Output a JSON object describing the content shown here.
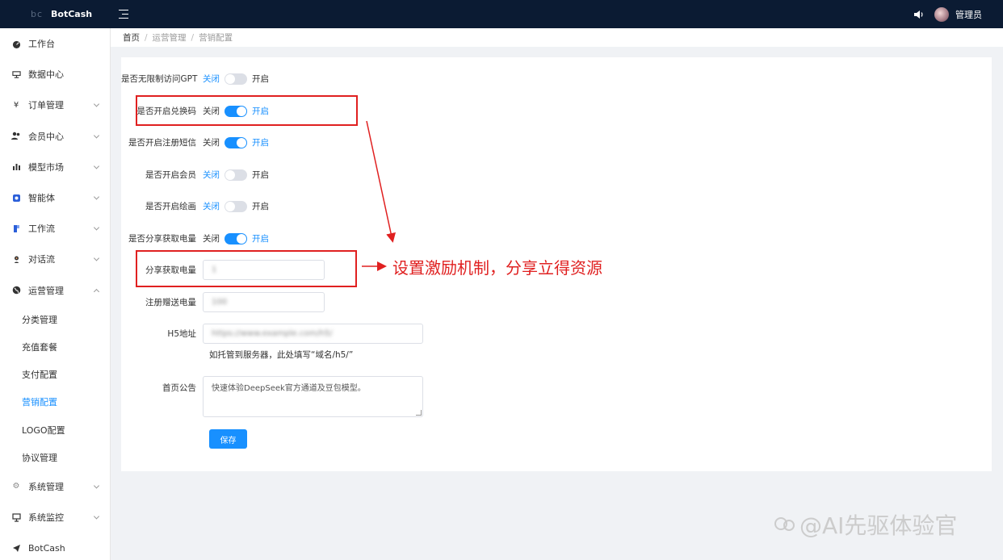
{
  "topbar": {
    "logo_text": "bc",
    "brand": "BotCash",
    "admin": "管理员"
  },
  "sidebar": {
    "items": [
      {
        "label": "工作台",
        "icon": "dashboard-icon"
      },
      {
        "label": "数据中心",
        "icon": "data-icon"
      },
      {
        "label": "订单管理",
        "icon": "yen-icon"
      },
      {
        "label": "会员中心",
        "icon": "users-icon"
      },
      {
        "label": "模型市场",
        "icon": "bar-chart-icon"
      },
      {
        "label": "智能体",
        "icon": "agent-icon"
      },
      {
        "label": "工作流",
        "icon": "workflow-icon"
      },
      {
        "label": "对话流",
        "icon": "chat-icon"
      },
      {
        "label": "运营管理",
        "icon": "globe-icon"
      }
    ],
    "sub_items": [
      "分类管理",
      "充值套餐",
      "支付配置",
      "营销配置",
      "LOGO配置",
      "协议管理"
    ],
    "bottom_items": [
      {
        "label": "系统管理",
        "icon": "gear-icon"
      },
      {
        "label": "系统监控",
        "icon": "monitor-icon"
      },
      {
        "label": "BotCash",
        "icon": "send-icon"
      }
    ]
  },
  "breadcrumb": {
    "home": "首页",
    "level1": "运营管理",
    "level2": "营销配置"
  },
  "form": {
    "off_label": "关闭",
    "on_label": "开启",
    "rows": [
      {
        "label": "是否无限制访问GPT",
        "state": "off"
      },
      {
        "label": "是否开启兑换码",
        "state": "on"
      },
      {
        "label": "是否开启注册短信",
        "state": "on"
      },
      {
        "label": "是否开启会员",
        "state": "off"
      },
      {
        "label": "是否开启绘画",
        "state": "off"
      },
      {
        "label": "是否分享获取电量",
        "state": "on"
      }
    ],
    "share_power_label": "分享获取电量",
    "share_power_value": "1",
    "register_power_label": "注册赠送电量",
    "register_power_value": "100",
    "h5_label": "H5地址",
    "h5_value": "https://www.example.com/h5/",
    "h5_hint": "如托管到服务器，此处填写“域名/h5/”",
    "notice_label": "首页公告",
    "notice_value": "快速体验DeepSeek官方通道及豆包模型。",
    "save_label": "保存"
  },
  "annotation": {
    "text": "设置激励机制，分享立得资源",
    "color": "#e02020"
  },
  "watermark": "@AI先驱体验官",
  "colors": {
    "topbar": "#0b1b33",
    "accent": "#1890ff"
  }
}
